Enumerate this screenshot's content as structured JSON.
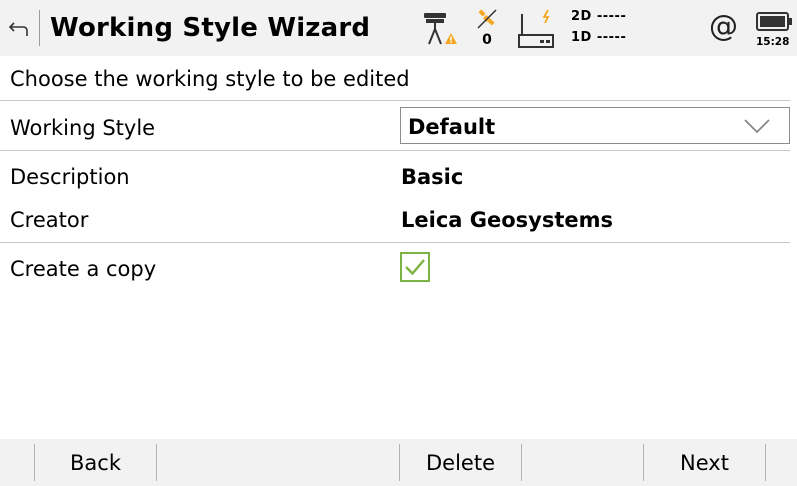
{
  "header": {
    "title": "Working Style Wizard",
    "back_icon": "back-arrow-icon",
    "icons": [
      "gnss-antenna-warning-icon",
      "satellite-icon",
      "radio-link-icon",
      "at-icon",
      "battery-icon"
    ],
    "satellite_count": "0",
    "position_2d": "2D -----",
    "position_1d": "1D -----",
    "at_symbol": "@",
    "time": "15:28",
    "warning_color": "#f5a623",
    "satellite_color": "#f5a623"
  },
  "main": {
    "prompt": "Choose the working style to be edited",
    "rows": [
      {
        "label": "Working Style",
        "value": "Default"
      },
      {
        "label": "Description",
        "value": "Basic"
      },
      {
        "label": "Creator",
        "value": "Leica Geosystems"
      },
      {
        "label": "Create a copy",
        "checked": true
      }
    ],
    "checkbox_color": "#7cb342"
  },
  "footer": {
    "buttons": [
      "Back",
      "Delete",
      "Next"
    ]
  }
}
